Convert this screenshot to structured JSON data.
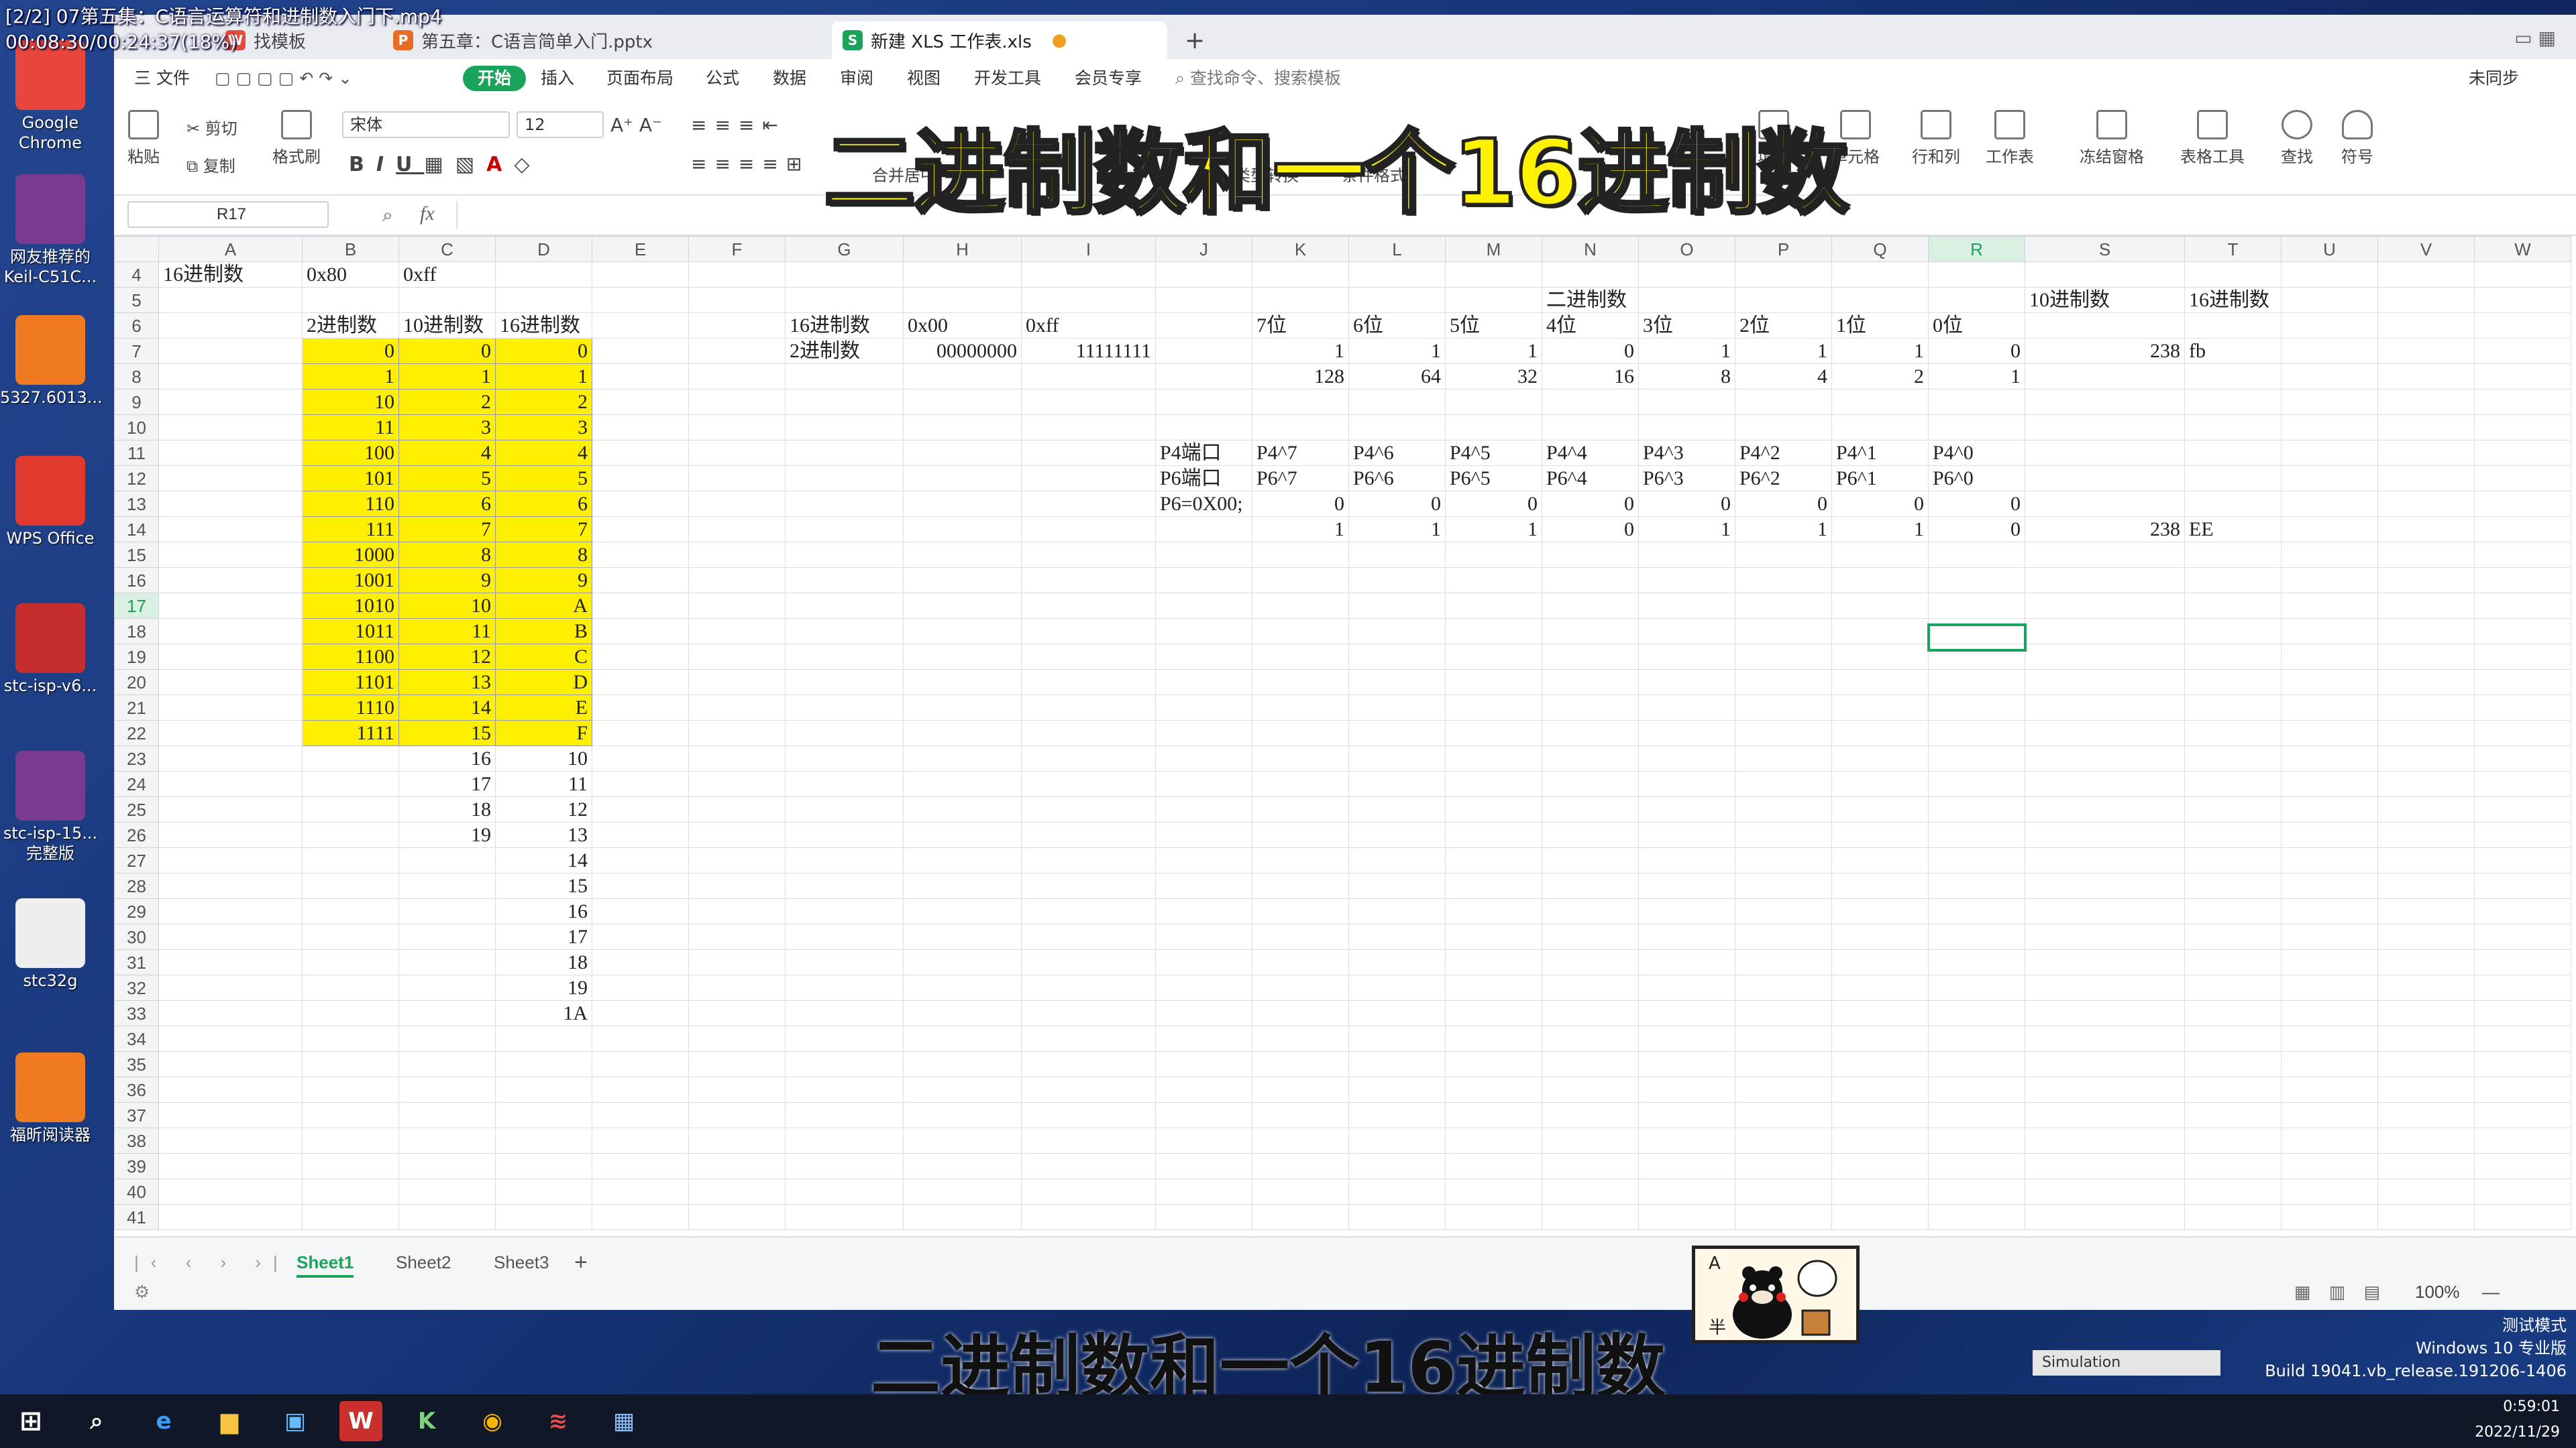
{
  "video_overlay": {
    "line1": "[2/2] 07第五集：C语言运算符和进制数入门下.mp4",
    "line2": "00:08:30/00:24:37(18%)"
  },
  "desktop_icons": [
    {
      "label": "Google Chrome",
      "icon": "chrome-icon",
      "color": "#e8453c"
    },
    {
      "label": "网友推荐的 Keil-C51C...",
      "icon": "winrar-icon",
      "color": "#7a3b8f"
    },
    {
      "label": "5327.6013...",
      "icon": "pdf-icon",
      "color": "#f07a22"
    },
    {
      "label": "WPS Office",
      "icon": "wps-icon",
      "color": "#e03a2f"
    },
    {
      "label": "stc-isp-v6...",
      "icon": "stc-isp-icon",
      "color": "#c62d2d"
    },
    {
      "label": "stc-isp-15... 完整版",
      "icon": "winrar-icon",
      "color": "#7a3b8f"
    },
    {
      "label": "stc32g",
      "icon": "document-icon",
      "color": "#eeeeee"
    },
    {
      "label": "福昕阅读器",
      "icon": "foxit-icon",
      "color": "#f07a22"
    }
  ],
  "tabs": [
    {
      "label": "找模板"
    },
    {
      "label": "第五章：C语言简单入门.pptx"
    },
    {
      "label": "新建 XLS 工作表.xls"
    }
  ],
  "new_tab": "+",
  "menu": [
    "三 文件",
    "开始",
    "插入",
    "页面布局",
    "公式",
    "数据",
    "审阅",
    "视图",
    "开发工具",
    "会员专享",
    "查找命令、搜索模板"
  ],
  "menu_right": [
    "未同步"
  ],
  "ribbon": {
    "paste": "粘贴",
    "cut": "剪切",
    "copy": "复制",
    "format_painter": "格式刷",
    "font": "宋体",
    "size": "12",
    "merge": "合并居中",
    "type_convert": "类型转换",
    "cond_format": "条件格式",
    "fill": "填充",
    "cell": "单元格",
    "rowcol": "行和列",
    "worksheet": "工作表",
    "freeze": "冻结窗格",
    "table_tools": "表格工具",
    "find": "查找",
    "symbol": "符号"
  },
  "name_box": "R17",
  "fx": "fx",
  "columns": [
    "A",
    "B",
    "C",
    "D",
    "E",
    "F",
    "G",
    "H",
    "I",
    "J",
    "K",
    "L",
    "M",
    "N",
    "O",
    "P",
    "Q",
    "R",
    "S",
    "T",
    "U",
    "V",
    "W"
  ],
  "rows": [
    {
      "n": "4",
      "c": {
        "A": "16进制数",
        "B": "0x80",
        "C": "0xff"
      }
    },
    {
      "n": "5",
      "c": {
        "N": "二进制数",
        "S": "10进制数",
        "T": "16进制数"
      }
    },
    {
      "n": "6",
      "c": {
        "B": "2进制数",
        "C": "10进制数",
        "D": "16进制数",
        "G": "16进制数",
        "H": "0x00",
        "I": "0xff",
        "K": "7位",
        "L": "6位",
        "M": "5位",
        "N": "4位",
        "O": "3位",
        "P": "2位",
        "Q": "1位",
        "R": "0位"
      }
    },
    {
      "n": "7",
      "c": {
        "B": "0",
        "C": "0",
        "D": "0",
        "G": "2进制数",
        "H": "00000000",
        "I": "11111111",
        "K": "1",
        "L": "1",
        "M": "1",
        "N": "0",
        "O": "1",
        "P": "1",
        "Q": "1",
        "R": "0",
        "S": "238",
        "T": "fb"
      }
    },
    {
      "n": "8",
      "c": {
        "B": "1",
        "C": "1",
        "D": "1",
        "K": "128",
        "L": "64",
        "M": "32",
        "N": "16",
        "O": "8",
        "P": "4",
        "Q": "2",
        "R": "1"
      }
    },
    {
      "n": "9",
      "c": {
        "B": "10",
        "C": "2",
        "D": "2"
      }
    },
    {
      "n": "10",
      "c": {
        "B": "11",
        "C": "3",
        "D": "3"
      }
    },
    {
      "n": "11",
      "c": {
        "B": "100",
        "C": "4",
        "D": "4",
        "J": "P4端口",
        "K": "P4^7",
        "L": "P4^6",
        "M": "P4^5",
        "N": "P4^4",
        "O": "P4^3",
        "P": "P4^2",
        "Q": "P4^1",
        "R": "P4^0"
      }
    },
    {
      "n": "12",
      "c": {
        "B": "101",
        "C": "5",
        "D": "5",
        "J": "P6端口",
        "K": "P6^7",
        "L": "P6^6",
        "M": "P6^5",
        "N": "P6^4",
        "O": "P6^3",
        "P": "P6^2",
        "Q": "P6^1",
        "R": "P6^0"
      }
    },
    {
      "n": "13",
      "c": {
        "B": "110",
        "C": "6",
        "D": "6",
        "J": "P6=0X00;",
        "K": "0",
        "L": "0",
        "M": "0",
        "N": "0",
        "O": "0",
        "P": "0",
        "Q": "0",
        "R": "0"
      }
    },
    {
      "n": "14",
      "c": {
        "B": "111",
        "C": "7",
        "D": "7",
        "K": "1",
        "L": "1",
        "M": "1",
        "N": "0",
        "O": "1",
        "P": "1",
        "Q": "1",
        "R": "0",
        "S": "238",
        "T": "EE"
      }
    },
    {
      "n": "15",
      "c": {
        "B": "1000",
        "C": "8",
        "D": "8"
      }
    },
    {
      "n": "16",
      "c": {
        "B": "1001",
        "C": "9",
        "D": "9"
      }
    },
    {
      "n": "17",
      "c": {
        "B": "1010",
        "C": "10",
        "D": "A"
      }
    },
    {
      "n": "18",
      "c": {
        "B": "1011",
        "C": "11",
        "D": "B"
      }
    },
    {
      "n": "19",
      "c": {
        "B": "1100",
        "C": "12",
        "D": "C"
      }
    },
    {
      "n": "20",
      "c": {
        "B": "1101",
        "C": "13",
        "D": "D"
      }
    },
    {
      "n": "21",
      "c": {
        "B": "1110",
        "C": "14",
        "D": "E"
      }
    },
    {
      "n": "22",
      "c": {
        "B": "1111",
        "C": "15",
        "D": "F"
      }
    },
    {
      "n": "23",
      "c": {
        "C": "16",
        "D": "10"
      }
    },
    {
      "n": "24",
      "c": {
        "C": "17",
        "D": "11"
      }
    },
    {
      "n": "25",
      "c": {
        "C": "18",
        "D": "12"
      }
    },
    {
      "n": "26",
      "c": {
        "C": "19",
        "D": "13"
      }
    },
    {
      "n": "27",
      "c": {
        "D": "14"
      }
    },
    {
      "n": "28",
      "c": {
        "D": "15"
      }
    },
    {
      "n": "29",
      "c": {
        "D": "16"
      }
    },
    {
      "n": "30",
      "c": {
        "D": "17"
      }
    },
    {
      "n": "31",
      "c": {
        "D": "18"
      }
    },
    {
      "n": "32",
      "c": {
        "D": "19"
      }
    },
    {
      "n": "33",
      "c": {
        "D": "1A"
      }
    },
    {
      "n": "34",
      "c": {}
    },
    {
      "n": "35",
      "c": {}
    },
    {
      "n": "36",
      "c": {}
    },
    {
      "n": "37",
      "c": {}
    },
    {
      "n": "38",
      "c": {}
    },
    {
      "n": "39",
      "c": {}
    },
    {
      "n": "40",
      "c": {}
    },
    {
      "n": "41",
      "c": {}
    }
  ],
  "highlight": {
    "cols": [
      "B",
      "C",
      "D"
    ],
    "from_row": 7,
    "to_row": 22,
    "color": "#fff000"
  },
  "active_cell": "R17",
  "sheet_tabs": [
    "Sheet1",
    "Sheet2",
    "Sheet3"
  ],
  "add_sheet": "+",
  "zoom": "100%",
  "title_overlay": "二进制数和一个16进制数",
  "subtitle_overlay": "二进制数和一个16进制数",
  "simulation": "Simulation",
  "windows_watermark": [
    "测试模式",
    "Windows 10 专业版",
    "Build 19041.vb_release.191206-1406"
  ],
  "clock": {
    "time": "0:59:01",
    "date": "2022/11/29"
  },
  "accent_color": "#1aa35a"
}
